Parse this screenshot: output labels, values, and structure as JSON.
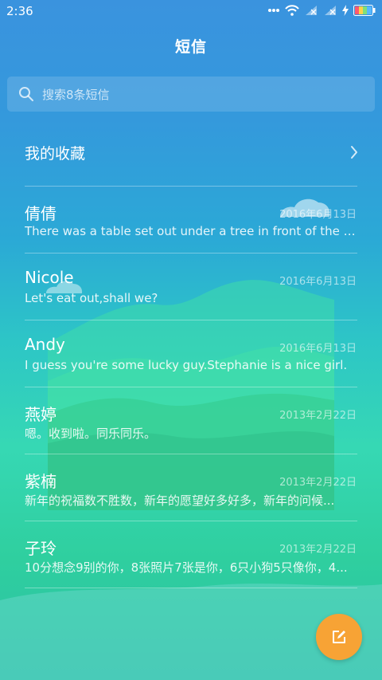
{
  "status_bar": {
    "time": "2:36",
    "icons": [
      "more-dots-icon",
      "wifi-icon",
      "signal-1-icon",
      "signal-2-icon",
      "charging-icon",
      "battery-icon"
    ]
  },
  "header": {
    "title": "短信"
  },
  "search": {
    "placeholder": "搜索8条短信"
  },
  "favorites": {
    "label": "我的收藏"
  },
  "conversations": [
    {
      "name": "倩倩",
      "date": "2016年6月13日",
      "preview": "There was a table set out under a tree in front of the ho..."
    },
    {
      "name": "Nicole",
      "date": "2016年6月13日",
      "preview": "Let's eat out,shall we?"
    },
    {
      "name": "Andy",
      "date": "2016年6月13日",
      "preview": "I guess you're some lucky guy.Stephanie is a nice girl."
    },
    {
      "name": "燕婷",
      "date": "2013年2月22日",
      "preview": "嗯。收到啦。同乐同乐。"
    },
    {
      "name": "紫楠",
      "date": "2013年2月22日",
      "preview": "新年的祝福数不胜数，新年的愿望好多好多，新年的问候..."
    },
    {
      "name": "子玲",
      "date": "2013年2月22日",
      "preview": "10分想念9别的你，8张照片7张是你，6只小狗5只像你，4..."
    }
  ],
  "colors": {
    "accent_fab": "#f7a335",
    "text": "#ffffff"
  }
}
